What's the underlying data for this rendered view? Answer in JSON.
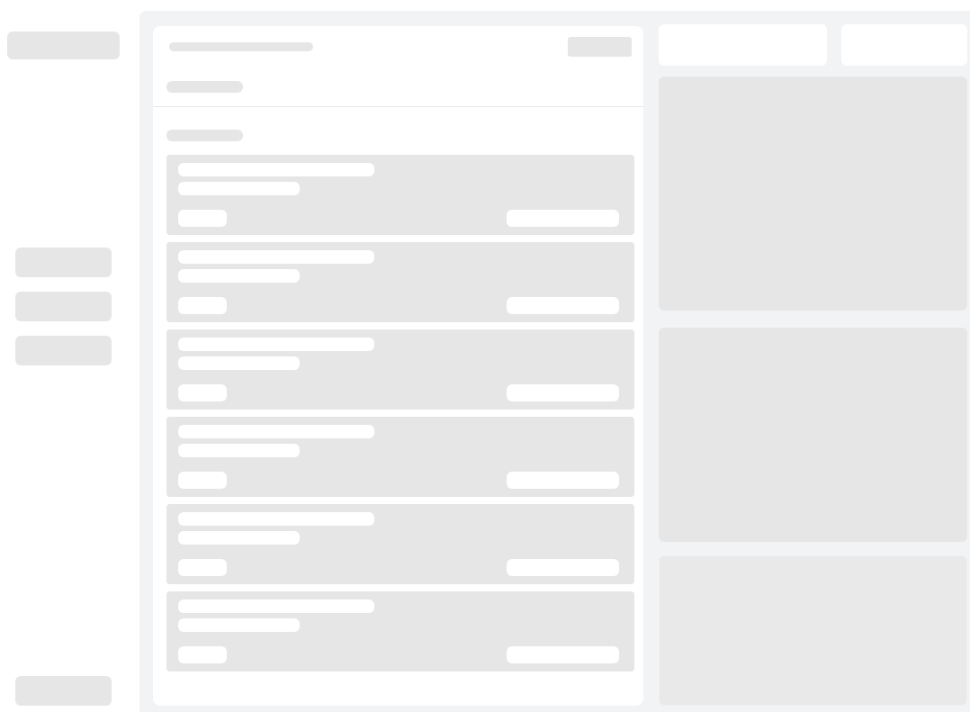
{
  "loading": true,
  "sidebar": {
    "logo": {
      "kind": "block"
    },
    "nav_items": [
      {
        "kind": "block"
      },
      {
        "kind": "block"
      },
      {
        "kind": "block"
      }
    ],
    "footer_item": {
      "kind": "block"
    }
  },
  "feed": {
    "header": {
      "title": {
        "kind": "line"
      },
      "action": {
        "kind": "button"
      },
      "subtitle": {
        "kind": "line"
      }
    },
    "section_label": {
      "kind": "line"
    },
    "items": [
      {
        "kind": "row"
      },
      {
        "kind": "row"
      },
      {
        "kind": "row"
      },
      {
        "kind": "row"
      },
      {
        "kind": "row"
      },
      {
        "kind": "row"
      }
    ]
  },
  "summary": {
    "stats": [
      {
        "kind": "tile"
      },
      {
        "kind": "tile"
      }
    ],
    "panels": [
      {
        "kind": "panel"
      },
      {
        "kind": "panel"
      },
      {
        "kind": "panel"
      }
    ]
  }
}
